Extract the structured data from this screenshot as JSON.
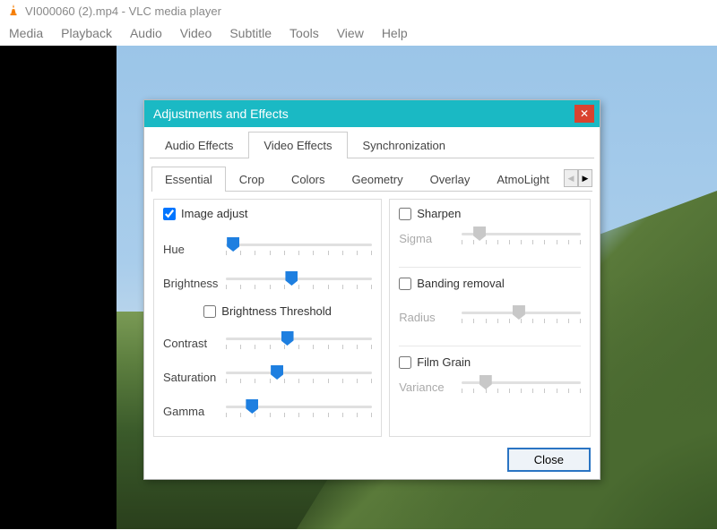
{
  "window": {
    "title": "VI000060 (2).mp4 - VLC media player"
  },
  "menu": {
    "items": [
      "Media",
      "Playback",
      "Audio",
      "Video",
      "Subtitle",
      "Tools",
      "View",
      "Help"
    ]
  },
  "dialog": {
    "title": "Adjustments and Effects",
    "tabs_main": [
      "Audio Effects",
      "Video Effects",
      "Synchronization"
    ],
    "tabs_main_active": 1,
    "tabs_sub": [
      "Essential",
      "Crop",
      "Colors",
      "Geometry",
      "Overlay",
      "AtmoLight"
    ],
    "tabs_sub_active": 0,
    "close_label": "Close"
  },
  "image_adjust": {
    "label": "Image adjust",
    "checked": true,
    "hue": {
      "label": "Hue",
      "value": 5
    },
    "brightness": {
      "label": "Brightness",
      "value": 45
    },
    "threshold_label": "Brightness Threshold",
    "threshold_checked": false,
    "contrast": {
      "label": "Contrast",
      "value": 42
    },
    "saturation": {
      "label": "Saturation",
      "value": 35
    },
    "gamma": {
      "label": "Gamma",
      "value": 18
    }
  },
  "sharpen": {
    "label": "Sharpen",
    "checked": false,
    "sigma": {
      "label": "Sigma",
      "value": 15
    }
  },
  "banding": {
    "label": "Banding removal",
    "checked": false,
    "radius": {
      "label": "Radius",
      "value": 48
    }
  },
  "filmgrain": {
    "label": "Film Grain",
    "checked": false,
    "variance": {
      "label": "Variance",
      "value": 20
    }
  }
}
